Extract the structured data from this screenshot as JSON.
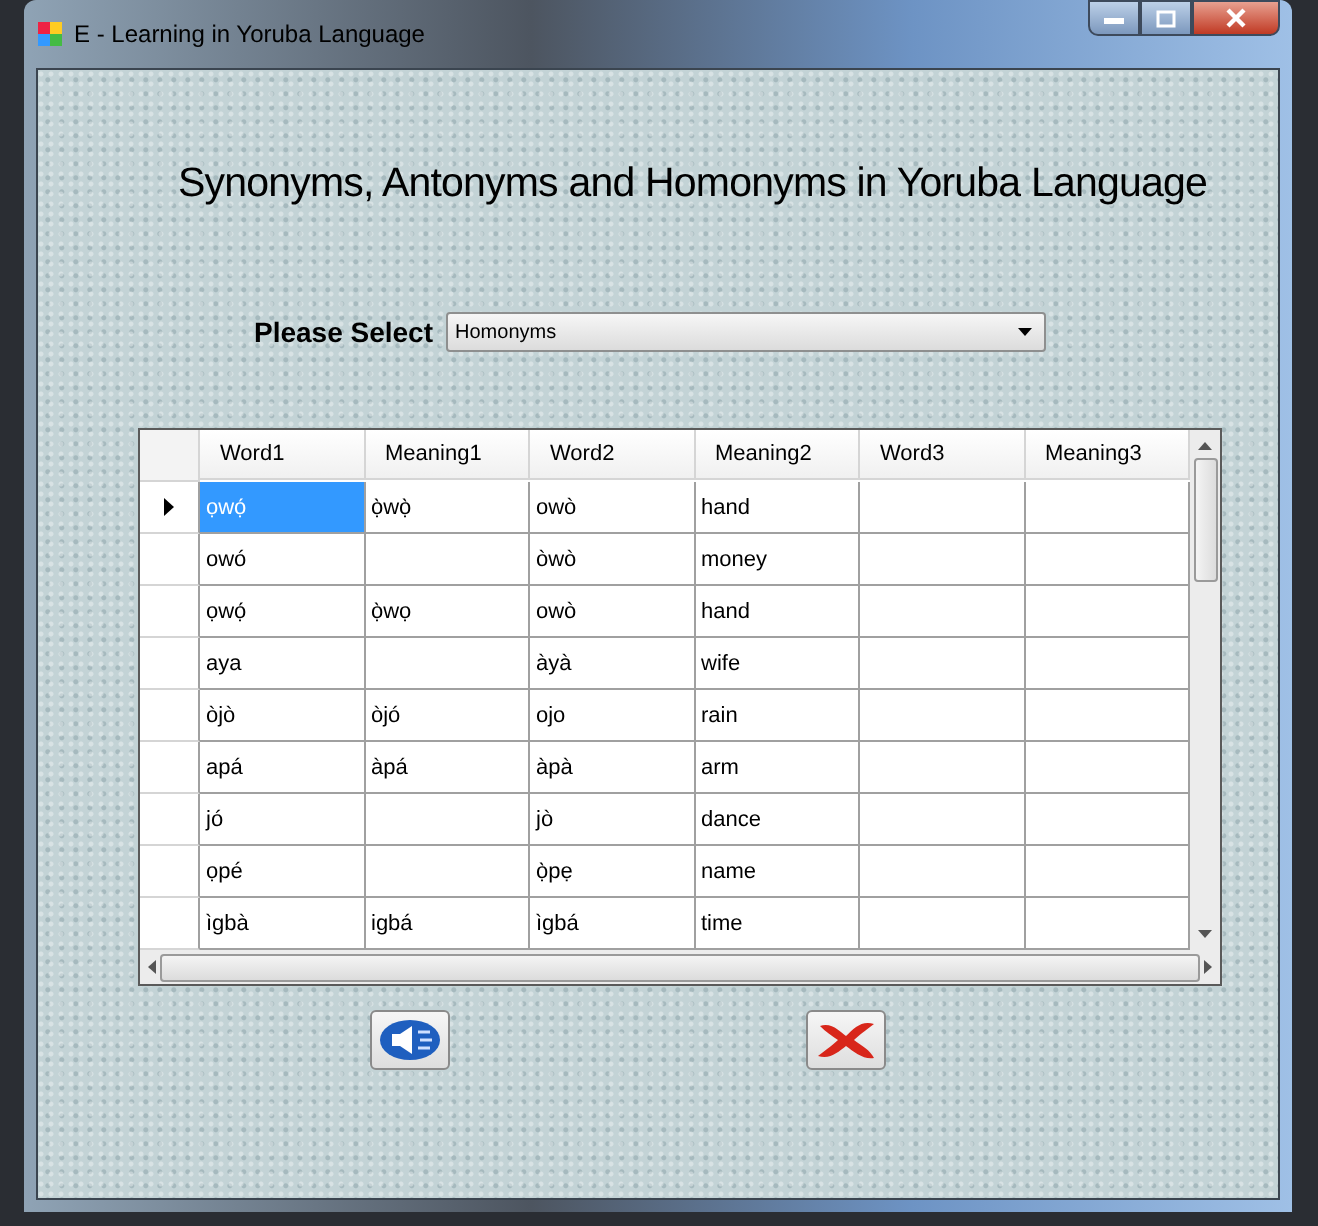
{
  "window": {
    "title": "E - Learning in Yoruba Language"
  },
  "heading": "Synonyms, Antonyms and Homonyms in Yoruba Language",
  "selector": {
    "label": "Please Select",
    "value": "Homonyms"
  },
  "table": {
    "columns": [
      "Word1",
      "Meaning1",
      "Word2",
      "Meaning2",
      "Word3",
      "Meaning3"
    ],
    "rows": [
      {
        "selected": true,
        "cells": [
          "ọwọ́",
          "ọ̀wọ̀",
          "owò",
          "hand",
          "",
          ""
        ]
      },
      {
        "selected": false,
        "cells": [
          "owó",
          "",
          "òwò",
          "money",
          "",
          ""
        ]
      },
      {
        "selected": false,
        "cells": [
          "ọwọ́",
          "ọ̀wọ",
          "owò",
          "hand",
          "",
          ""
        ]
      },
      {
        "selected": false,
        "cells": [
          "aya",
          "",
          "àyà",
          "wife",
          "",
          ""
        ]
      },
      {
        "selected": false,
        "cells": [
          "òjò",
          "òjó",
          "ojo",
          "rain",
          "",
          ""
        ]
      },
      {
        "selected": false,
        "cells": [
          "apá",
          "àpá",
          "àpà",
          "arm",
          "",
          ""
        ]
      },
      {
        "selected": false,
        "cells": [
          "jó",
          "",
          "jò",
          "dance",
          "",
          ""
        ]
      },
      {
        "selected": false,
        "cells": [
          "ọpé",
          "",
          "ọ̀pẹ",
          "name",
          "",
          ""
        ]
      },
      {
        "selected": false,
        "cells": [
          "ìgbà",
          "igbá",
          "ìgbá",
          "time",
          "",
          ""
        ]
      }
    ]
  }
}
